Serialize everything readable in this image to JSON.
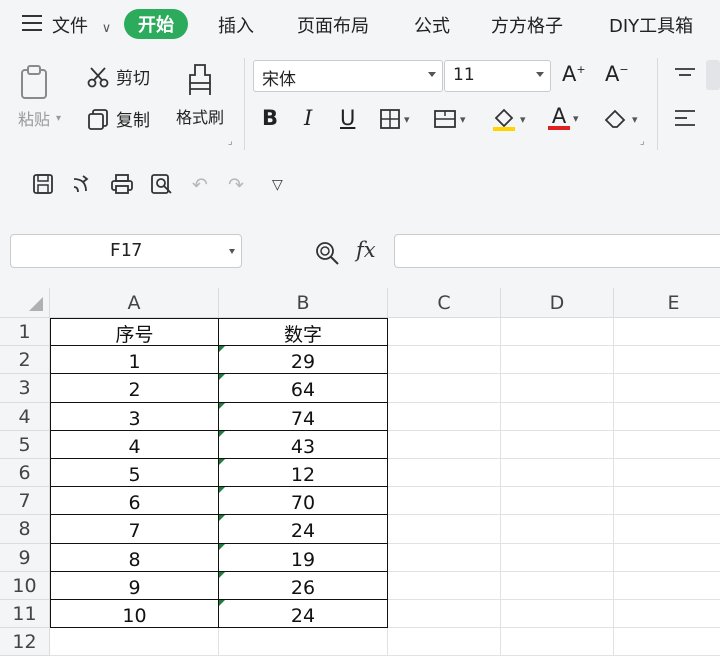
{
  "menu": {
    "file": "文件",
    "tabs": [
      "开始",
      "插入",
      "页面布局",
      "公式",
      "方方格子",
      "DIY工具箱"
    ],
    "active_tab": "开始"
  },
  "ribbon": {
    "paste": "粘贴",
    "cut": "剪切",
    "copy": "复制",
    "format_painter": "格式刷",
    "font_name": "宋体",
    "font_size": "11",
    "grow": "A",
    "shrink": "A",
    "bold": "B",
    "italic": "I",
    "underline": "U",
    "font_color_letter": "A"
  },
  "formula_bar": {
    "name_box": "F17",
    "fx": "fx",
    "value": ""
  },
  "sheet": {
    "columns": [
      "A",
      "B",
      "C",
      "D",
      "E"
    ],
    "rows": [
      "1",
      "2",
      "3",
      "4",
      "5",
      "6",
      "7",
      "8",
      "9",
      "10",
      "11",
      "12"
    ],
    "header": [
      "序号",
      "数字"
    ],
    "data": [
      [
        "1",
        "29"
      ],
      [
        "2",
        "64"
      ],
      [
        "3",
        "74"
      ],
      [
        "4",
        "43"
      ],
      [
        "5",
        "12"
      ],
      [
        "6",
        "70"
      ],
      [
        "7",
        "24"
      ],
      [
        "8",
        "19"
      ],
      [
        "9",
        "26"
      ],
      [
        "10",
        "24"
      ]
    ]
  },
  "colors": {
    "accent": "#2dab5d",
    "text_error_triangle": "#1e7d3e",
    "font_color_bar": "#e02020",
    "highlight_bar": "#ffd400"
  }
}
